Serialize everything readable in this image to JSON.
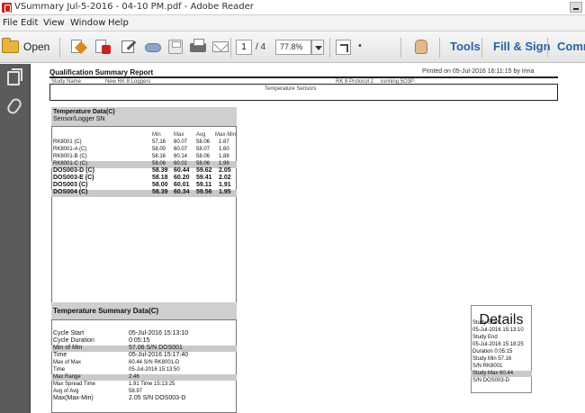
{
  "window": {
    "title": "VSummary Jul-5-2016 - 04-10 PM.pdf - Adobe Reader"
  },
  "menu": [
    "File",
    "Edit",
    "View",
    "Window",
    "Help"
  ],
  "toolbar": {
    "open_label": "Open",
    "page_current": "1",
    "page_total": "/ 4",
    "zoom": "77.8%",
    "more": "•",
    "tools_label": "Tools",
    "fill_sign_label": "Fill & Sign",
    "comment_label": "Comm"
  },
  "report": {
    "title": "Qualification Summary Report",
    "printed": "Printed on 05-Jul-2016 16:11:15 by Irina",
    "study_name_label": "Study Name",
    "study_name": "New RK 8 Loggers",
    "protocol": "RK 8 Protocol 2",
    "running": "running 5O3P",
    "box_label": "Temperature Sensors",
    "panel_title": "Temperature Data(C)",
    "panel_subtitle": "Sensor/Logger SN",
    "columns": [
      "Min",
      "Max",
      "Avg",
      "Max-Min"
    ],
    "sensors": [
      {
        "name": "RK8001 (C)",
        "min": "57.16",
        "max": "60.07",
        "avg": "58.06",
        "diff": "1.87",
        "style": "plain"
      },
      {
        "name": "RK8001-A (C)",
        "min": "58.00",
        "max": "60.07",
        "avg": "58.07",
        "diff": "1.60",
        "style": "plain"
      },
      {
        "name": "RK8001-B (C)",
        "min": "58.16",
        "max": "60.14",
        "avg": "58.06",
        "diff": "1.88",
        "style": "plain"
      },
      {
        "name": "RK8001-C (C)",
        "min": "58.06",
        "max": "60.02",
        "avg": "58.06",
        "diff": "1.96",
        "style": "shaded"
      },
      {
        "name": "DOS003-D (C)",
        "min": "58.39",
        "max": "60.44",
        "avg": "59.62",
        "diff": "2.05",
        "style": "bold"
      },
      {
        "name": "DOS003-E (C)",
        "min": "58.18",
        "max": "60.20",
        "avg": "59.41",
        "diff": "2.02",
        "style": "bold"
      },
      {
        "name": "DOS003 (C)",
        "min": "58.00",
        "max": "60.01",
        "avg": "59.11",
        "diff": "1.91",
        "style": "bold"
      },
      {
        "name": "DOS004 (C)",
        "min": "58.39",
        "max": "60.34",
        "avg": "59.56",
        "diff": "1.95",
        "style": "bold-shaded"
      }
    ],
    "summary_title": "Temperature Summary Data(C)",
    "summary": [
      {
        "label": "Cycle Start",
        "value": "05-Jul-2016 15:13:10",
        "size": "big",
        "shade": false
      },
      {
        "label": "Cycle Duration",
        "value": "0:05:15",
        "size": "big",
        "shade": false
      },
      {
        "label": "Min of Min",
        "value": "57.06   S/N   DOS001",
        "size": "big",
        "shade": true
      },
      {
        "label": "Time",
        "value": "05-Jul-2016 15:17:40",
        "size": "big",
        "shade": false
      },
      {
        "label": "Max of Max",
        "value": "60.44   S/N   RK8001-D",
        "size": "small",
        "shade": false
      },
      {
        "label": "Time",
        "value": "05-Jul-2016 15:13:50",
        "size": "small",
        "shade": false
      },
      {
        "label": "Max Range",
        "value": "2.46",
        "size": "small",
        "shade": true
      },
      {
        "label": "Max Spread Time",
        "value": "1.91   Time   15:13:25",
        "size": "small",
        "shade": false
      },
      {
        "label": "Avg of Avg",
        "value": "58.97",
        "size": "small",
        "shade": false
      },
      {
        "label": "Max(Max-Min)",
        "value": "2.05   S/N   DOS003-D",
        "size": "big",
        "shade": false
      }
    ],
    "details_title": "Details",
    "details": [
      {
        "text": "Study Start",
        "shade": false
      },
      {
        "text": "05-Jul-2016 15:13:10",
        "shade": false
      },
      {
        "text": "Study End",
        "shade": false
      },
      {
        "text": "05-Jul-2016 15:18:25",
        "shade": false
      },
      {
        "text": "Duration     0:05:15",
        "shade": false
      },
      {
        "text": "Study Min      57.16",
        "shade": false
      },
      {
        "text": "S/N       RK8001",
        "shade": false
      },
      {
        "text": "Study Max      60.44",
        "shade": true
      },
      {
        "text": "S/N      DOS003-D",
        "shade": false
      }
    ]
  }
}
